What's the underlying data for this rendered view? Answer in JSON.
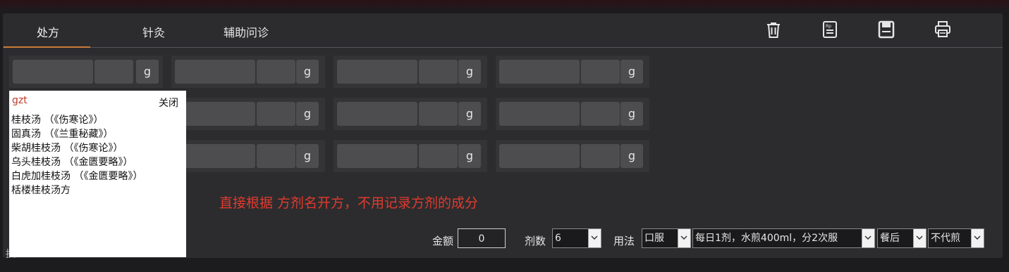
{
  "tabs": [
    {
      "label": "处方"
    },
    {
      "label": "针灸"
    },
    {
      "label": "辅助问诊"
    }
  ],
  "toolbar": {
    "icons": [
      "trash-icon",
      "prescription-icon",
      "save-icon",
      "print-icon"
    ]
  },
  "grid": {
    "unit": "g"
  },
  "dropdown": {
    "query": "gzt",
    "close_label": "关闭",
    "items": [
      "桂枝汤 （《伤寒论》）",
      "固真汤 （《兰重秘藏》）",
      "柴胡桂枝汤 （《伤寒论》）",
      "乌头桂枝汤 （《金匮要略》）",
      "白虎加桂枝汤 （《金匮要略》）",
      "栝楼桂枝汤方"
    ]
  },
  "note": "直接根据 方剂名开方，不用记录方剂的成分",
  "footer": {
    "cut_label": "拱",
    "amount_label": "金额",
    "amount_value": "0",
    "doses_label": "剂数",
    "doses_value": "6",
    "usage_label": "用法",
    "route_value": "口服",
    "frequency_value": "每日1剂，水煎400ml，分2次服",
    "timing_value": "餐后",
    "decoction_value": "不代煎"
  },
  "colors": {
    "accent": "#c97b3a",
    "note_red": "#e23a2e",
    "query_red": "#c0392b"
  }
}
